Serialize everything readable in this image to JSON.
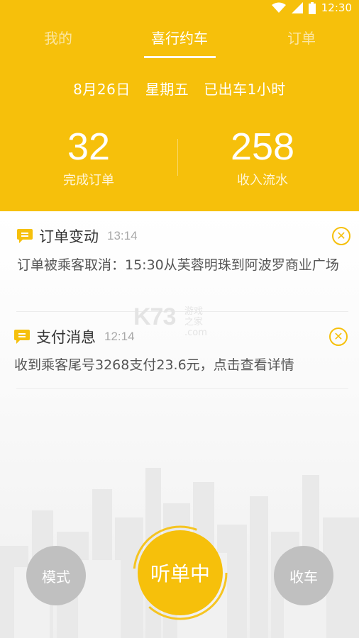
{
  "status_bar": {
    "time": "12:30"
  },
  "tabs": [
    {
      "label": "我的",
      "active": false
    },
    {
      "label": "喜行约车",
      "active": true
    },
    {
      "label": "订单",
      "active": false
    }
  ],
  "summary": {
    "date": "8月26日",
    "weekday": "星期五",
    "online_time": "已出车1小时",
    "completed_orders": {
      "value": "32",
      "label": "完成订单"
    },
    "revenue": {
      "value": "258",
      "label": "收入流水"
    }
  },
  "messages": [
    {
      "icon": "chat-bubble-icon",
      "title": "订单变动",
      "time": "13:14",
      "body": "订单被乘客取消：15:30从芙蓉明珠到阿波罗商业广场"
    },
    {
      "icon": "chat-bubble-icon",
      "title": "支付消息",
      "time": "12:14",
      "body": "收到乘客尾号3268支付23.6元，点击查看详情"
    }
  ],
  "watermark": {
    "main": "K73",
    "side_top": "游戏之家",
    "side_bottom": ".com"
  },
  "actions": {
    "mode_label": "模式",
    "listen_label": "听单中",
    "close_label": "收车"
  },
  "colors": {
    "accent": "#f6c00b",
    "button_gray": "#c0c0c0"
  }
}
